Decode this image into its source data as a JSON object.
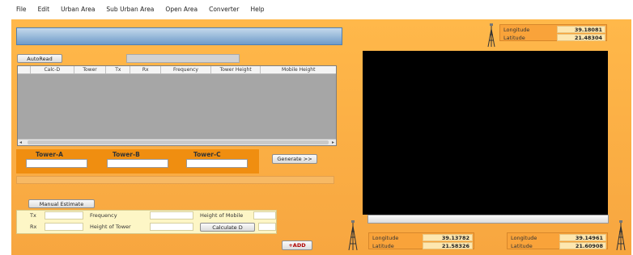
{
  "menu": [
    "File",
    "Edit",
    "Urban Area",
    "Sub Urban Area",
    "Open Area",
    "Converter",
    "Help"
  ],
  "buttons": {
    "autoread": "AutoRead",
    "generate": "Generate >>",
    "manual_estimate": "Manual Estimate",
    "calculate": "Calculate D",
    "add": "+ADD"
  },
  "grid": {
    "columns": [
      "",
      "Calc-D",
      "Tower",
      "Tx",
      "Rx",
      "Frequency",
      "Tower Height",
      "Mobile Height"
    ]
  },
  "towers": {
    "a": "Tower-A",
    "b": "Tower-B",
    "c": "Tower-C"
  },
  "estimate": {
    "tx": "Tx",
    "rx": "Rx",
    "frequency": "Frequency",
    "height_tower": "Height of Tower",
    "height_mobile": "Height of Mobile"
  },
  "coords": {
    "top_right": {
      "longitude_label": "Longitude",
      "longitude": "39.18081",
      "latitude_label": "Latitude",
      "latitude": "21.48304"
    },
    "bottom_left": {
      "longitude_label": "Longitude",
      "longitude": "39.13782",
      "latitude_label": "Latitude",
      "latitude": "21.58326"
    },
    "bottom_right": {
      "longitude_label": "Longitude",
      "longitude": "39.14961",
      "latitude_label": "Latitude",
      "latitude": "21.60908"
    }
  },
  "colors": {
    "panel": "#f7a640",
    "tower_panel": "#f08e10",
    "title_bar": "#6f9bc8",
    "screen": "#000000",
    "estimate_bg": "#fdf6c6"
  }
}
